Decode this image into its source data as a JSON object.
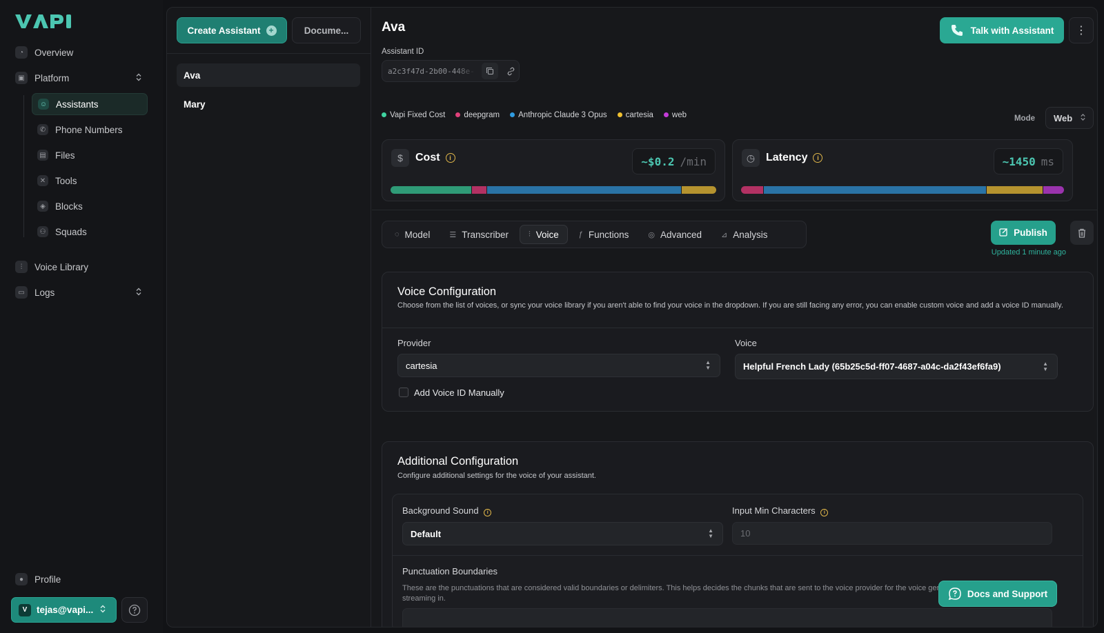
{
  "sidebar": {
    "logo": "VAPI",
    "items": {
      "overview": "Overview",
      "platform": "Platform",
      "voice_library": "Voice Library",
      "logs": "Logs",
      "profile": "Profile"
    },
    "platform_sub": [
      "Assistants",
      "Phone Numbers",
      "Files",
      "Tools",
      "Blocks",
      "Squads"
    ],
    "user": "tejas@vapi...",
    "user_avatar": "V"
  },
  "list": {
    "create_label": "Create Assistant",
    "docs_label": "Docume...",
    "assistants": [
      "Ava",
      "Mary"
    ]
  },
  "assistant": {
    "name": "Ava",
    "talk_label": "Talk with Assistant",
    "id_label": "Assistant ID",
    "id_value": "a2c3f47d-2b00-448e-"
  },
  "legend": [
    {
      "label": "Vapi Fixed Cost",
      "color": "#3fd3a0"
    },
    {
      "label": "deepgram",
      "color": "#e0407a"
    },
    {
      "label": "Anthropic Claude 3 Opus",
      "color": "#2f9be0"
    },
    {
      "label": "cartesia",
      "color": "#f0c030"
    },
    {
      "label": "web",
      "color": "#c43bd8"
    }
  ],
  "mode": {
    "label": "Mode",
    "value": "Web"
  },
  "cost": {
    "title": "Cost",
    "value": "~$0.2",
    "unit": "/min",
    "segments": [
      {
        "pct": 24.7,
        "color": "#2f9b77"
      },
      {
        "pct": 4.8,
        "color": "#b23163"
      },
      {
        "pct": 59.7,
        "color": "#2a73a6"
      },
      {
        "pct": 10.8,
        "color": "#b5932f"
      }
    ]
  },
  "latency": {
    "title": "Latency",
    "value": "~1450",
    "unit": "ms",
    "segments": [
      {
        "pct": 6.8,
        "color": "#b23163"
      },
      {
        "pct": 69.0,
        "color": "#2a73a6"
      },
      {
        "pct": 17.5,
        "color": "#b5932f"
      },
      {
        "pct": 6.7,
        "color": "#9a33ad"
      }
    ]
  },
  "tabs": [
    "Model",
    "Transcriber",
    "Voice",
    "Functions",
    "Advanced",
    "Analysis"
  ],
  "active_tab": "Voice",
  "publish_label": "Publish",
  "updated_text": "Updated 1 minute ago",
  "voice_config": {
    "title": "Voice Configuration",
    "desc": "Choose from the list of voices, or sync your voice library if you aren't able to find your voice in the dropdown. If you are still facing any error, you can enable custom voice and add a voice ID manually.",
    "provider_label": "Provider",
    "provider_value": "cartesia",
    "voice_label": "Voice",
    "voice_value": "Helpful French Lady (65b25c5d-ff07-4687-a04c-da2f43ef6fa9)",
    "manual_label": "Add Voice ID Manually"
  },
  "additional_config": {
    "title": "Additional Configuration",
    "desc": "Configure additional settings for the voice of your assistant.",
    "bg_sound_label": "Background Sound",
    "bg_sound_value": "Default",
    "min_chars_label": "Input Min Characters",
    "min_chars_placeholder": "10",
    "punct_label": "Punctuation Boundaries",
    "punct_desc": "These are the punctuations that are considered valid boundaries or delimiters. This helps decides the chunks that are sent to the voice provider for the voice generation as the LLM tokens are streaming in."
  },
  "docs_support_label": "Docs and Support"
}
